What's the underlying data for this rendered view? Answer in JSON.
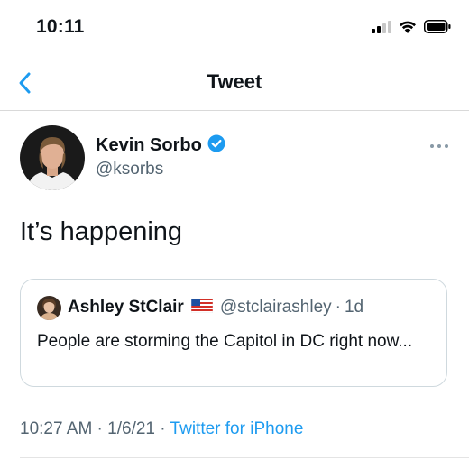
{
  "status_bar": {
    "time": "10:11"
  },
  "nav": {
    "title": "Tweet"
  },
  "tweet": {
    "author_name": "Kevin Sorbo",
    "author_handle": "@ksorbs",
    "verified": true,
    "text": "It’s happening",
    "quoted": {
      "name": "Ashley StClair",
      "flag": "🇺🇸",
      "handle": "@stclairashley",
      "separator": "·",
      "time": "1d",
      "text": "People are storming the Capitol in DC right now..."
    },
    "timestamp": "10:27 AM · 1/6/21",
    "meta_separator": "·",
    "source": "Twitter for iPhone"
  },
  "colors": {
    "accent": "#1d9bf0",
    "secondary_text": "#536471",
    "border": "#cfd9de"
  },
  "icons": [
    "back-chevron-icon",
    "verified-badge-icon",
    "more-icon",
    "cellular-signal-icon",
    "wifi-icon",
    "battery-icon",
    "us-flag-icon"
  ]
}
